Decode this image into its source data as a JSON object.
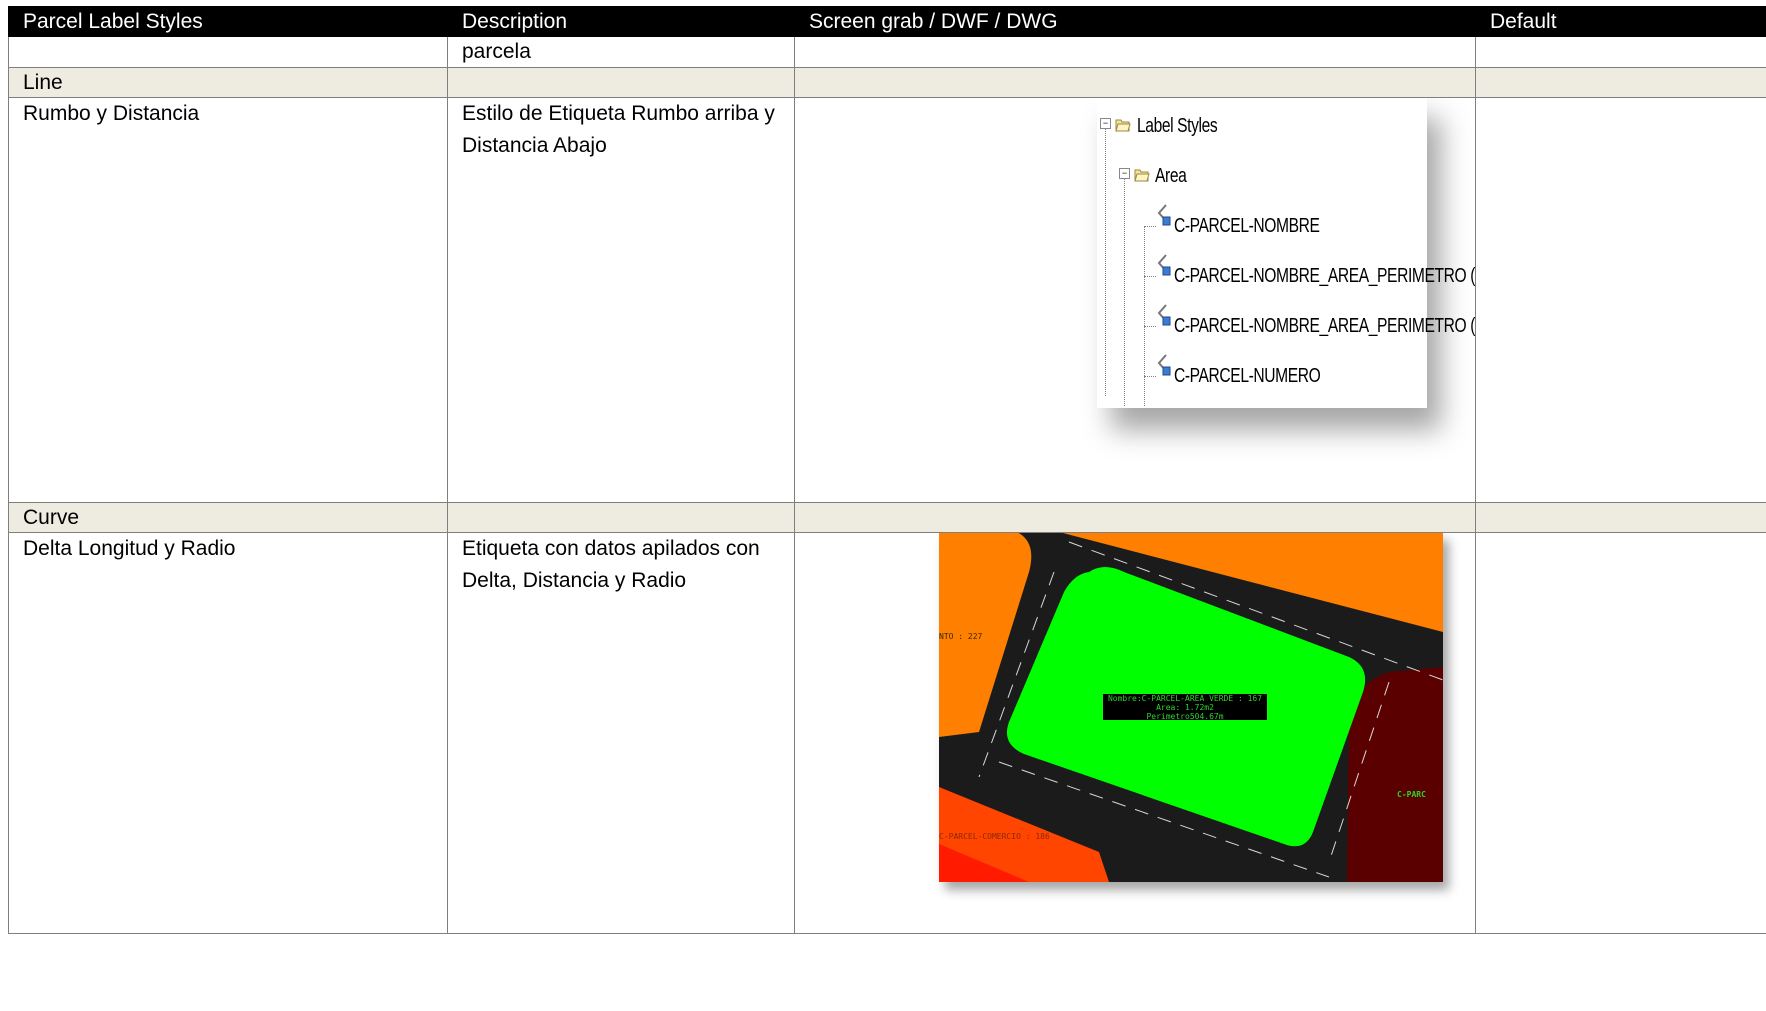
{
  "table": {
    "headers": [
      "Parcel Label Styles",
      "Description",
      "Screen grab / DWF / DWG",
      "Default"
    ],
    "row_parcela": {
      "col2": "parcela"
    },
    "section_line": "Line",
    "row_rumbo": {
      "name": "Rumbo y Distancia",
      "description": "Estilo de Etiqueta Rumbo arriba y Distancia Abajo"
    },
    "section_curve": "Curve",
    "row_delta": {
      "name": "Delta Longitud y Radio",
      "description": "Etiqueta con datos apilados con Delta, Distancia y Radio"
    }
  },
  "tree_screenshot": {
    "root": "Label Styles",
    "folder": "Area",
    "items": [
      "C-PARCEL-NOMBRE",
      "C-PARCEL-NOMBRE_AREA_PERIMETRO (Has)",
      "C-PARCEL-NOMBRE_AREA_PERIMETRO (Metros)",
      "C-PARCEL-NUMERO"
    ],
    "icons": [
      "expand-minus-icon",
      "folder-open-icon",
      "label-style-icon"
    ]
  },
  "drawing_screenshot": {
    "center_label": [
      "Nombre:C-PARCEL-AREA VERDE : 167",
      "Area: 1.72m2",
      "Perimetro504.67m"
    ],
    "left_label": "NTO : 227",
    "bottom_label": "C-PARCEL-COMERCIO : 186",
    "right_label": "C-PARC",
    "colors": {
      "background": "#1b1b1b",
      "parcel_green": "#00ff00",
      "parcel_orange": "#ff7f00",
      "parcel_red": "#ff3300",
      "parcel_dark_red": "#5a0000",
      "label_text": "#2ad52a"
    }
  }
}
